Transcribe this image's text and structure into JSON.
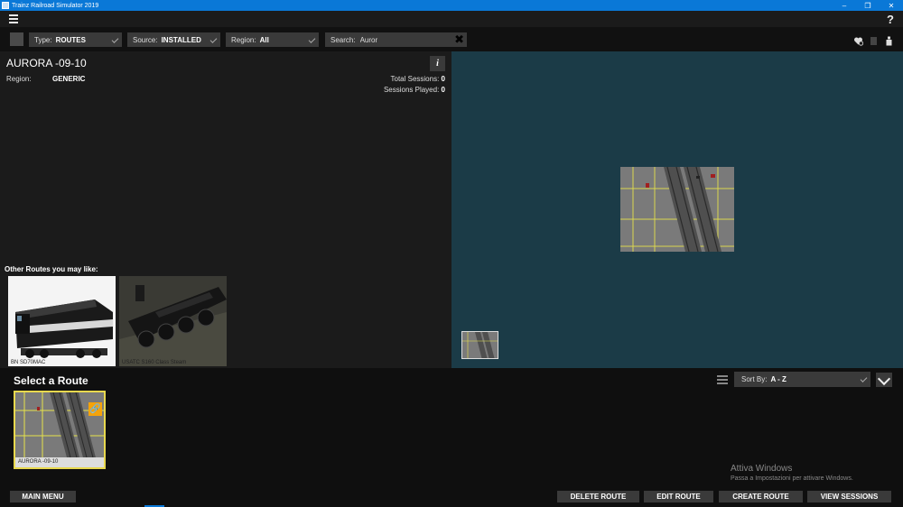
{
  "window": {
    "title": "Trainz Railroad Simulator 2019"
  },
  "filters": {
    "type_label": "Type:",
    "type_value": "ROUTES",
    "source_label": "Source:",
    "source_value": "INSTALLED",
    "region_label": "Region:",
    "region_value": "All",
    "search_label": "Search:",
    "search_value": "Auror"
  },
  "route": {
    "title": "AURORA -09-10",
    "region_label": "Region:",
    "region_value": "GENERIC",
    "total_sessions_label": "Total Sessions:",
    "total_sessions": "0",
    "sessions_played_label": "Sessions Played:",
    "sessions_played": "0"
  },
  "recommendations": {
    "label": "Other Routes you may like:",
    "items": [
      {
        "caption": "BN SD70MAC"
      },
      {
        "caption": "USATC S160 Class Steam"
      }
    ]
  },
  "select": {
    "title": "Select a Route",
    "sort_label": "Sort By:",
    "sort_value": "A - Z",
    "cards": [
      {
        "caption": "AURORA -09-10"
      }
    ]
  },
  "watermark": {
    "line1": "Attiva Windows",
    "line2": "Passa a Impostazioni per attivare Windows."
  },
  "footer": {
    "main_menu": "MAIN MENU",
    "delete_route": "DELETE ROUTE",
    "edit_route": "EDIT ROUTE",
    "create_route": "CREATE ROUTE",
    "view_sessions": "VIEW SESSIONS"
  }
}
